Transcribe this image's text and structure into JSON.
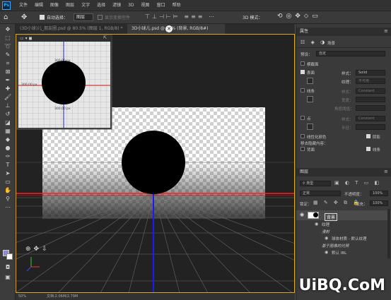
{
  "app": {
    "logo": "Ps"
  },
  "menubar": {
    "items": [
      "文件",
      "编辑",
      "图像",
      "图层",
      "文字",
      "选择",
      "滤镜",
      "3D",
      "视图",
      "窗口",
      "帮助"
    ]
  },
  "options": {
    "auto_select_label": "自动选择：",
    "auto_select_value": "图层",
    "show_transform": "显示变换控件",
    "mode_label": "3D 模式："
  },
  "tabs": [
    {
      "label": "(3D小球)儿_朋友圈.psd @ 80.5% (图层 1, RGB/8) *"
    },
    {
      "label": "3D小球儿.psd @ 50% (背景, RGB/8#)"
    }
  ],
  "camera_view": {
    "measure_top": "300.00 px",
    "measure_bottom": "300.00 px",
    "measure_left": "300.00 px"
  },
  "status": {
    "zoom": "50%",
    "doc": "文档:2.06M/2.79M"
  },
  "properties": {
    "title": "属性",
    "tab_label": "场景",
    "preset_label": "预设：",
    "preset_value": "自定",
    "cross_section_label": "横截面",
    "surface_label": "表面",
    "surface_style_label": "样式：",
    "surface_style_value": "Solid",
    "texture_label": "纹理：",
    "texture_value": "不可用",
    "lines_label": "线条",
    "lines_style_value": "Constant",
    "width_label": "宽度：",
    "angle_label": "角度阈值：",
    "points_label": "点",
    "points_style_value": "Constant",
    "radius_label": "半径：",
    "linearize_label": "线性化颜色",
    "shadow_label": "阴影",
    "remove_hidden_label": "移去隐藏内容：",
    "back_label": "背面",
    "lines_cb_label": "线条"
  },
  "layers": {
    "title": "图层",
    "filter_label": "类型",
    "blend_mode": "正常",
    "opacity_label": "不透明度：",
    "opacity_value": "100%",
    "lock_label": "锁定：",
    "fill_label": "填充：",
    "fill_value": "100%",
    "layer_name": "背景",
    "sub_items": [
      {
        "label": "纹理"
      },
      {
        "label": "漫射"
      },
      {
        "label": "球体材质 - 默认纹理"
      },
      {
        "label": "基于图像的光照"
      },
      {
        "label": "默认 IBL"
      }
    ]
  },
  "watermark": "UiBQ.CoM"
}
